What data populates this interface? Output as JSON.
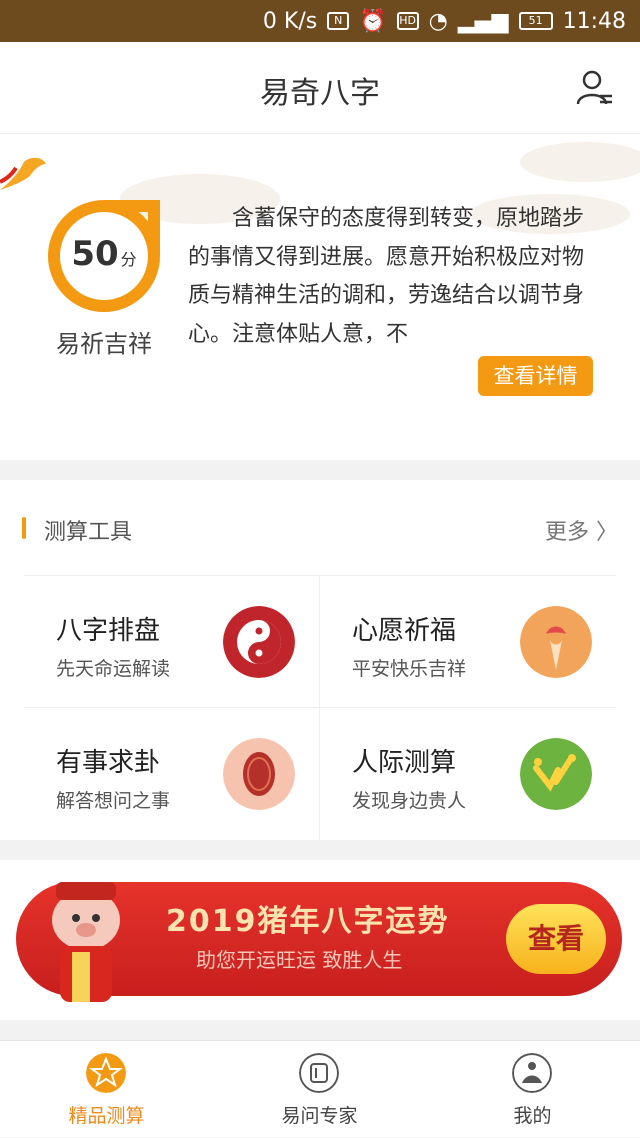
{
  "status_bar": {
    "speed": "0 K/s",
    "battery": "51",
    "time": "11:48"
  },
  "header": {
    "title": "易奇八字"
  },
  "hero": {
    "score": "50",
    "score_unit": "分",
    "score_label": "易祈吉祥",
    "fortune_text": "含蓄保守的态度得到转变，原地踏步的事情又得到进展。愿意开始积极应对物质与精神生活的调和，劳逸结合以调节身心。注意体贴人意，不",
    "detail_button": "查看详情"
  },
  "tools": {
    "title": "测算工具",
    "more": "更多",
    "items": [
      {
        "title": "八字排盘",
        "subtitle": "先天命运解读",
        "icon": "yin-yang-icon"
      },
      {
        "title": "心愿祈福",
        "subtitle": "平安快乐吉祥",
        "icon": "prayer-lotus-icon"
      },
      {
        "title": "有事求卦",
        "subtitle": "解答想问之事",
        "icon": "tortoise-shell-icon"
      },
      {
        "title": "人际测算",
        "subtitle": "发现身边贵人",
        "icon": "people-icon"
      }
    ]
  },
  "banner": {
    "title": "2019猪年八字运势",
    "subtitle": "助您开运旺运 致胜人生",
    "button": "查看"
  },
  "tabbar": {
    "items": [
      {
        "label": "精品测算",
        "active": true
      },
      {
        "label": "易问专家",
        "active": false
      },
      {
        "label": "我的",
        "active": false
      }
    ]
  },
  "colors": {
    "accent": "#f39a12",
    "status_bar": "#6e4a1f",
    "banner_red": "#e6332a"
  }
}
